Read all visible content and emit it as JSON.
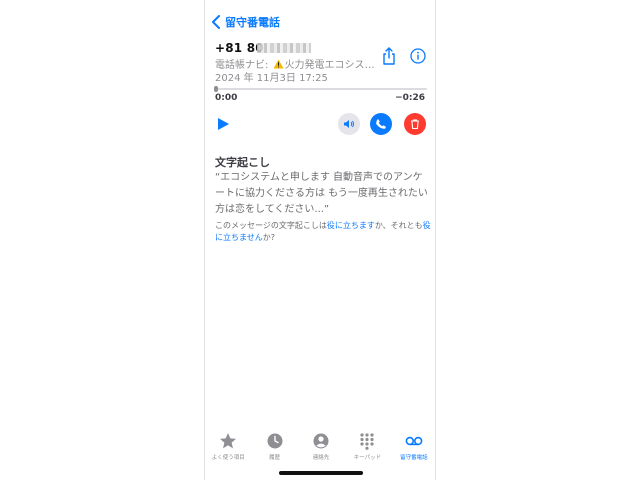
{
  "nav": {
    "back_label": "留守番電話"
  },
  "voicemail": {
    "number_visible": "+81 80",
    "caller_prefix": "電話帳ナビ: ",
    "caller_name": "火力発電エコシステ…",
    "date": "2024 年 11月3日 17:25",
    "elapsed": "0:00",
    "remaining": "−0:26",
    "progress": 0.0
  },
  "transcript": {
    "title": "文字起こし",
    "text": "“エコシステムと申します 自動音声でのアンケートに協力くださる方は もう一度再生されたい方は恋をしてください...”",
    "feedback_before": "このメッセージの文字起こしは",
    "feedback_useful": "役に立ちます",
    "feedback_middle": "か、それとも",
    "feedback_not_useful": "役に立ちません",
    "feedback_after": "か?"
  },
  "tabs": [
    {
      "label": "よく使う項目",
      "icon": "star-icon"
    },
    {
      "label": "履歴",
      "icon": "clock-icon"
    },
    {
      "label": "連絡先",
      "icon": "contact-icon"
    },
    {
      "label": "キーパッド",
      "icon": "keypad-icon"
    },
    {
      "label": "留守番電話",
      "icon": "voicemail-icon",
      "active": true
    }
  ],
  "colors": {
    "accent": "#0a7aff",
    "call": "#0a7aff",
    "delete": "#ff3b30",
    "secondary_text": "#8e8e93",
    "warning": "#f5b800"
  }
}
